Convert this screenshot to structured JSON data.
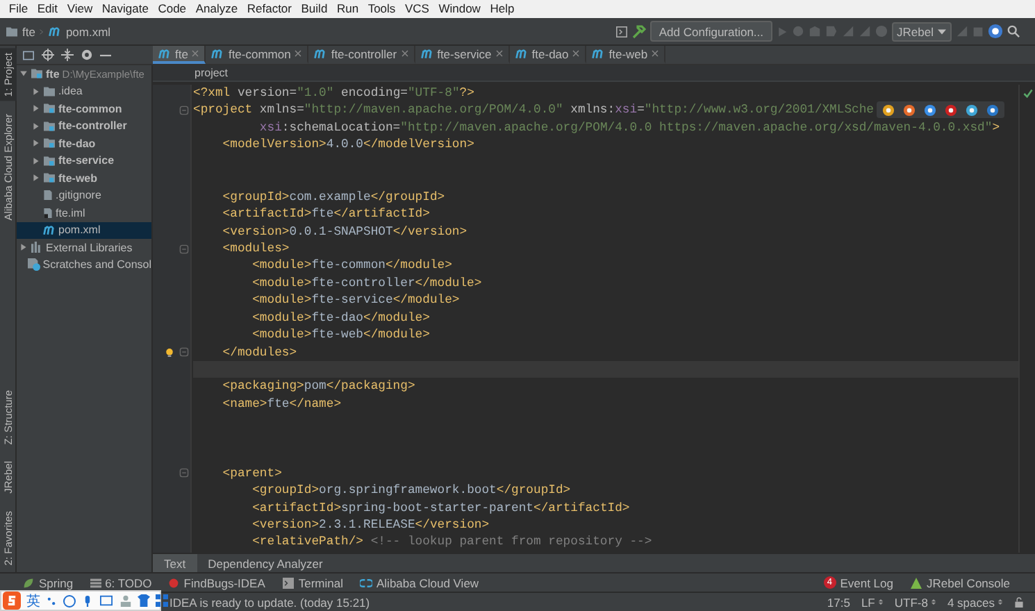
{
  "menu": [
    "File",
    "Edit",
    "View",
    "Navigate",
    "Code",
    "Analyze",
    "Refactor",
    "Build",
    "Run",
    "Tools",
    "VCS",
    "Window",
    "Help"
  ],
  "breadcrumb": [
    {
      "label": "fte",
      "kind": "folder"
    },
    {
      "label": "pom.xml",
      "kind": "maven"
    }
  ],
  "toolbar": {
    "config_button": "Add Configuration...",
    "jrebel_select": "JRebel"
  },
  "left_strip": {
    "top": [
      {
        "label": "1: Project",
        "selected": true
      },
      {
        "label": "Alibaba Cloud Explorer",
        "selected": false
      }
    ],
    "bottom": [
      {
        "label": "Z: Structure",
        "selected": false
      },
      {
        "label": "JRebel",
        "selected": false
      },
      {
        "label": "2: Favorites",
        "selected": false
      }
    ]
  },
  "project_tree": [
    {
      "label": "fte",
      "path": "D:\\MyExample\\fte",
      "kind": "module",
      "expanded": true,
      "selected": false,
      "children": [
        {
          "label": ".idea",
          "kind": "folder",
          "expanded": false,
          "selected": false
        },
        {
          "label": "fte-common",
          "kind": "module",
          "expanded": false,
          "selected": false
        },
        {
          "label": "fte-controller",
          "kind": "module",
          "expanded": false,
          "selected": false
        },
        {
          "label": "fte-dao",
          "kind": "module",
          "expanded": false,
          "selected": false
        },
        {
          "label": "fte-service",
          "kind": "module",
          "expanded": false,
          "selected": false
        },
        {
          "label": "fte-web",
          "kind": "module",
          "expanded": false,
          "selected": false
        },
        {
          "label": ".gitignore",
          "kind": "file",
          "selected": false
        },
        {
          "label": "fte.iml",
          "kind": "iml",
          "selected": false
        },
        {
          "label": "pom.xml",
          "kind": "maven",
          "selected": true
        }
      ]
    },
    {
      "label": "External Libraries",
      "kind": "libraries",
      "expanded": false,
      "selected": false
    },
    {
      "label": "Scratches and Consol",
      "kind": "scratches",
      "selected": false
    }
  ],
  "editor_tabs": [
    {
      "label": "fte",
      "selected": true
    },
    {
      "label": "fte-common",
      "selected": false
    },
    {
      "label": "fte-controller",
      "selected": false
    },
    {
      "label": "fte-service",
      "selected": false
    },
    {
      "label": "fte-dao",
      "selected": false
    },
    {
      "label": "fte-web",
      "selected": false
    }
  ],
  "editor_breadcrumb": "project",
  "code_lines": [
    {
      "kind": "plain",
      "current": false,
      "segs": [
        {
          "kind": "tag",
          "text": "<?xml"
        },
        {
          "kind": "attr",
          "text": " version="
        },
        {
          "kind": "value",
          "text": "\"1.0\""
        },
        {
          "kind": "attr",
          "text": " encoding="
        },
        {
          "kind": "value",
          "text": "\"UTF-8\""
        },
        {
          "kind": "tag",
          "text": "?>"
        }
      ]
    },
    {
      "kind": "fold",
      "current": false,
      "segs": [
        {
          "kind": "tag",
          "text": "<project"
        },
        {
          "kind": "attr",
          "text": " xmlns="
        },
        {
          "kind": "value",
          "text": "\"http://maven.apache.org/POM/4.0.0\""
        },
        {
          "kind": "attr",
          "text": " xmlns:"
        },
        {
          "kind": "ns",
          "text": "xsi"
        },
        {
          "kind": "attr",
          "text": "="
        },
        {
          "kind": "value",
          "text": "\"http://www.w3.org/2001/XMLSche"
        }
      ]
    },
    {
      "kind": "plain",
      "current": false,
      "segs": [
        {
          "kind": "ns",
          "text": "         xsi"
        },
        {
          "kind": "attr",
          "text": ":schemaLocation="
        },
        {
          "kind": "value",
          "text": "\"http://maven.apache.org/POM/4.0.0 https://maven.apache.org/xsd/maven-4.0.0.xsd\""
        },
        {
          "kind": "tag",
          "text": ">"
        }
      ]
    },
    {
      "kind": "plain",
      "current": false,
      "segs": [
        {
          "kind": "tag",
          "text": "    <modelVersion>"
        },
        {
          "kind": "text",
          "text": "4.0.0"
        },
        {
          "kind": "tag",
          "text": "</modelVersion>"
        }
      ]
    },
    {
      "kind": "plain",
      "current": false
    },
    {
      "kind": "plain",
      "current": false
    },
    {
      "kind": "plain",
      "current": false,
      "segs": [
        {
          "kind": "tag",
          "text": "    <groupId>"
        },
        {
          "kind": "text",
          "text": "com.example"
        },
        {
          "kind": "tag",
          "text": "</groupId>"
        }
      ]
    },
    {
      "kind": "plain",
      "current": false,
      "segs": [
        {
          "kind": "tag",
          "text": "    <artifactId>"
        },
        {
          "kind": "text",
          "text": "fte"
        },
        {
          "kind": "tag",
          "text": "</artifactId>"
        }
      ]
    },
    {
      "kind": "plain",
      "current": false,
      "segs": [
        {
          "kind": "tag",
          "text": "    <version>"
        },
        {
          "kind": "text",
          "text": "0.0.1-SNAPSHOT"
        },
        {
          "kind": "tag",
          "text": "</version>"
        }
      ]
    },
    {
      "kind": "fold",
      "current": false,
      "segs": [
        {
          "kind": "tag",
          "text": "    <modules>"
        }
      ]
    },
    {
      "kind": "plain",
      "current": false,
      "segs": [
        {
          "kind": "tag",
          "text": "        <module>"
        },
        {
          "kind": "text",
          "text": "fte-common"
        },
        {
          "kind": "tag",
          "text": "</module>"
        }
      ]
    },
    {
      "kind": "plain",
      "current": false,
      "segs": [
        {
          "kind": "tag",
          "text": "        <module>"
        },
        {
          "kind": "text",
          "text": "fte-controller"
        },
        {
          "kind": "tag",
          "text": "</module>"
        }
      ]
    },
    {
      "kind": "plain",
      "current": false,
      "segs": [
        {
          "kind": "tag",
          "text": "        <module>"
        },
        {
          "kind": "text",
          "text": "fte-service"
        },
        {
          "kind": "tag",
          "text": "</module>"
        }
      ]
    },
    {
      "kind": "plain",
      "current": false,
      "segs": [
        {
          "kind": "tag",
          "text": "        <module>"
        },
        {
          "kind": "text",
          "text": "fte-dao"
        },
        {
          "kind": "tag",
          "text": "</module>"
        }
      ]
    },
    {
      "kind": "plain",
      "current": false,
      "segs": [
        {
          "kind": "tag",
          "text": "        <module>"
        },
        {
          "kind": "text",
          "text": "fte-web"
        },
        {
          "kind": "tag",
          "text": "</module>"
        }
      ]
    },
    {
      "kind": "fold-bulb",
      "current": false,
      "segs": [
        {
          "kind": "tag",
          "text": "    </modules>"
        }
      ]
    },
    {
      "kind": "plain",
      "current": true
    },
    {
      "kind": "plain",
      "current": false,
      "segs": [
        {
          "kind": "tag",
          "text": "    <packaging>"
        },
        {
          "kind": "text",
          "text": "pom"
        },
        {
          "kind": "tag",
          "text": "</packaging>"
        }
      ]
    },
    {
      "kind": "plain",
      "current": false,
      "segs": [
        {
          "kind": "tag",
          "text": "    <name>"
        },
        {
          "kind": "text",
          "text": "fte"
        },
        {
          "kind": "tag",
          "text": "</name>"
        }
      ]
    },
    {
      "kind": "plain",
      "current": false
    },
    {
      "kind": "plain",
      "current": false
    },
    {
      "kind": "plain",
      "current": false
    },
    {
      "kind": "fold",
      "current": false,
      "segs": [
        {
          "kind": "tag",
          "text": "    <parent>"
        }
      ]
    },
    {
      "kind": "plain",
      "current": false,
      "segs": [
        {
          "kind": "tag",
          "text": "        <groupId>"
        },
        {
          "kind": "text",
          "text": "org.springframework.boot"
        },
        {
          "kind": "tag",
          "text": "</groupId>"
        }
      ]
    },
    {
      "kind": "plain",
      "current": false,
      "segs": [
        {
          "kind": "tag",
          "text": "        <artifactId>"
        },
        {
          "kind": "text",
          "text": "spring-boot-starter-parent"
        },
        {
          "kind": "tag",
          "text": "</artifactId>"
        }
      ]
    },
    {
      "kind": "plain",
      "current": false,
      "segs": [
        {
          "kind": "tag",
          "text": "        <version>"
        },
        {
          "kind": "text",
          "text": "2.3.1.RELEASE"
        },
        {
          "kind": "tag",
          "text": "</version>"
        }
      ]
    },
    {
      "kind": "plain",
      "current": false,
      "segs": [
        {
          "kind": "tag",
          "text": "        <relativePath/>"
        },
        {
          "kind": "comment",
          "text": " <!-- lookup parent from repository -->"
        }
      ]
    }
  ],
  "editor_bottom_tabs": [
    {
      "label": "Text",
      "selected": true
    },
    {
      "label": "Dependency Analyzer",
      "selected": false
    }
  ],
  "tool_windows": {
    "left": [
      {
        "label": "Spring",
        "kind": "spring"
      },
      {
        "label": "6: TODO",
        "kind": "todo"
      },
      {
        "label": "FindBugs-IDEA",
        "kind": "findbugs"
      },
      {
        "label": "Terminal",
        "kind": "terminal"
      },
      {
        "label": "Alibaba Cloud View",
        "kind": "cloud"
      }
    ],
    "right": [
      {
        "label": "Event Log",
        "kind": "eventlog",
        "badge": "4"
      },
      {
        "label": "JRebel Console",
        "kind": "jrebel"
      }
    ]
  },
  "status_bar": {
    "message": "IDEA is ready to update. (today 15:21)",
    "position": "17:5",
    "line_separator": "LF",
    "encoding": "UTF-8",
    "indent": "4 spaces"
  },
  "ime_bar": {
    "language": "英"
  }
}
